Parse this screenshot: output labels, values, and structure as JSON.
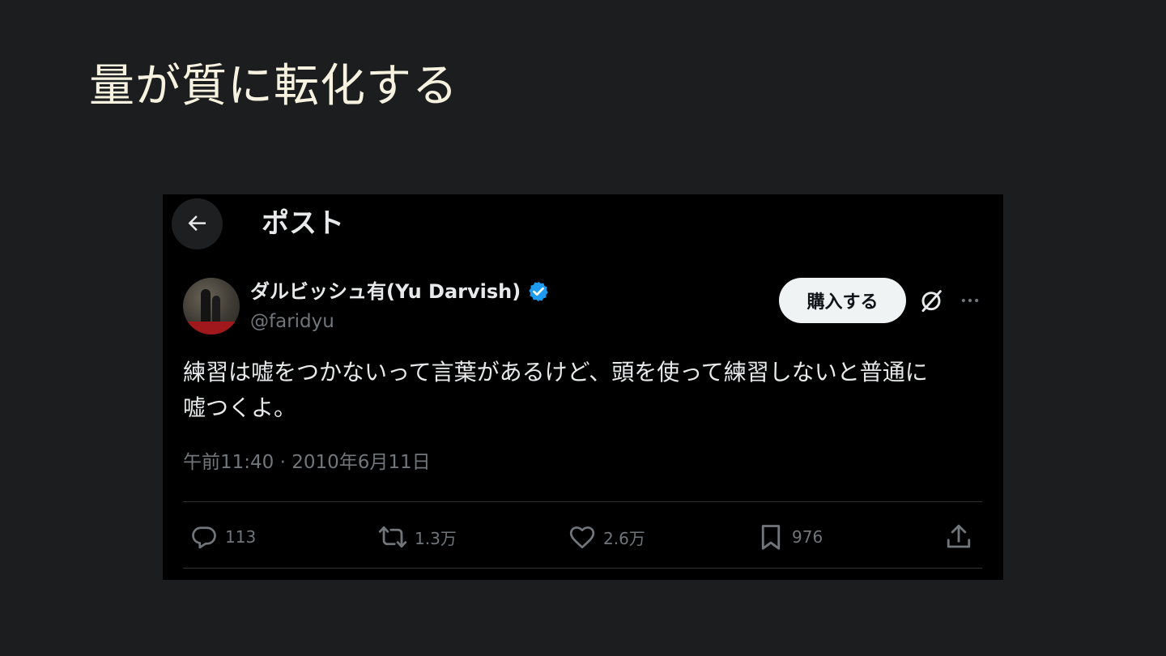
{
  "slide": {
    "title": "量が質に転化する"
  },
  "post": {
    "header": {
      "back_icon": "arrow-left-icon",
      "title": "ポスト"
    },
    "author": {
      "display_name": "ダルビッシュ有(Yu Darvish)",
      "handle": "@faridyu",
      "verified_icon": "verified-badge-icon"
    },
    "buy_button_label": "購入する",
    "grok_icon": "grok-icon",
    "more_icon": "more-options-icon",
    "text_line1": "練習は嘘をつかないって言葉があるけど、頭を使って練習しないと普通に",
    "text_line2": "嘘つくよ。",
    "timestamp": "午前11:40 · 2010年6月11日",
    "metrics": {
      "replies": "113",
      "reposts": "1.3万",
      "likes": "2.6万",
      "bookmarks": "976"
    }
  },
  "colors": {
    "slide_bg": "#1c1d1f",
    "title_text": "#f6f2df",
    "card_bg": "#000000",
    "primary_text": "#e7e9ea",
    "secondary_text": "#71767b",
    "verified_blue": "#1d9bf0",
    "divider": "#2f3336",
    "buy_button_bg": "#eff3f4"
  }
}
